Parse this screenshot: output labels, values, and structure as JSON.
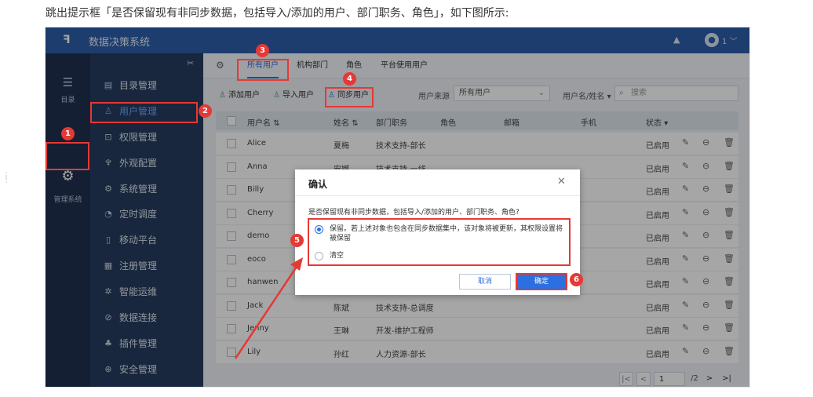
{
  "caption": "跳出提示框「是否保留现有非同步数据，包括导入/添加的用户、部门职务、角色」，如下图所示:",
  "app": {
    "title": "数据决策系统",
    "user_count": "1",
    "logo_glyph": "ꟻ"
  },
  "colors": {
    "topbar": "#2c5fa8",
    "rail": "#1f3150",
    "sidebar": "#263c5e",
    "accent": "#2c6fe0",
    "highlight": "#e53935"
  },
  "rail": [
    {
      "label": "目录",
      "icon": "list-icon"
    },
    {
      "label": "管理系统",
      "icon": "gear-icon"
    }
  ],
  "sidebar": {
    "items": [
      {
        "label": "目录管理",
        "icon": "catalog-icon"
      },
      {
        "label": "用户管理",
        "icon": "user-icon",
        "active": true
      },
      {
        "label": "权限管理",
        "icon": "lock-icon"
      },
      {
        "label": "外观配置",
        "icon": "brush-icon"
      },
      {
        "label": "系统管理",
        "icon": "gear-icon"
      },
      {
        "label": "定时调度",
        "icon": "timer-icon"
      },
      {
        "label": "移动平台",
        "icon": "mobile-icon"
      },
      {
        "label": "注册管理",
        "icon": "register-icon"
      },
      {
        "label": "智能运维",
        "icon": "ops-icon"
      },
      {
        "label": "数据连接",
        "icon": "link-icon"
      },
      {
        "label": "插件管理",
        "icon": "plugin-icon"
      },
      {
        "label": "安全管理",
        "icon": "shield-icon"
      }
    ]
  },
  "tabs": [
    "所有用户",
    "机构部门",
    "角色",
    "平台使用用户"
  ],
  "toolbar": {
    "add_user": "添加用户",
    "import_user": "导入用户",
    "sync_user": "同步用户",
    "source_label": "用户来源",
    "source_value": "所有用户",
    "name_filter": "用户名/姓名",
    "search_placeholder": "搜索"
  },
  "table": {
    "headers": {
      "username": "用户名",
      "name": "姓名",
      "position": "部门职务",
      "role": "角色",
      "email": "邮箱",
      "phone": "手机",
      "status": "状态"
    },
    "rows": [
      {
        "username": "Alice",
        "name": "夏梅",
        "position": "技术支持-部长",
        "status": "已启用"
      },
      {
        "username": "Anna",
        "name": "安娜",
        "position": "技术支持-一线",
        "status": "已启用"
      },
      {
        "username": "Billy",
        "name": "",
        "position": "",
        "status": "已启用"
      },
      {
        "username": "Cherry",
        "name": "",
        "position": "",
        "status": "已启用"
      },
      {
        "username": "demo",
        "name": "",
        "position": "",
        "status": "已启用"
      },
      {
        "username": "eoco",
        "name": "",
        "position": "",
        "status": "已启用"
      },
      {
        "username": "hanwen",
        "name": "",
        "position": "",
        "status": "已启用"
      },
      {
        "username": "Jack",
        "name": "陈斌",
        "position": "技术支持-总调度",
        "status": "已启用"
      },
      {
        "username": "Jenny",
        "name": "王琳",
        "position": "开发-维护工程师",
        "status": "已启用"
      },
      {
        "username": "Lily",
        "name": "孙红",
        "position": "人力资源-部长",
        "status": "已启用"
      }
    ]
  },
  "pager": {
    "current": "1",
    "total": "/2"
  },
  "dialog": {
    "title": "确认",
    "question": "是否保留现有非同步数据，包括导入/添加的用户、部门职务、角色?",
    "option_keep": "保留。若上述对象也包含在同步数据集中，该对象将被更新，其权限设置将被保留",
    "option_clear": "清空",
    "cancel": "取消",
    "confirm": "确定"
  },
  "badges": [
    "1",
    "2",
    "3",
    "4",
    "5",
    "6"
  ]
}
